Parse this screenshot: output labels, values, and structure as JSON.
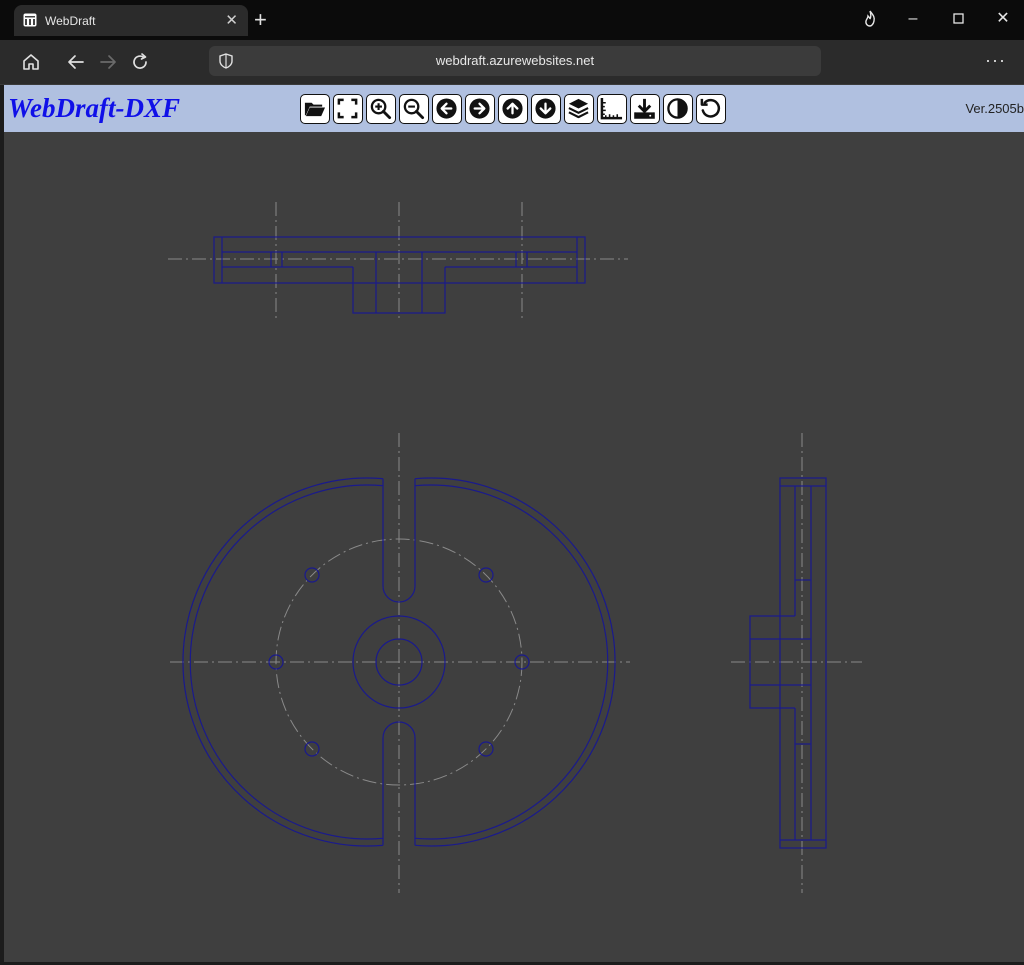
{
  "browser": {
    "tab_title": "WebDraft",
    "url": "webdraft.azurewebsites.net",
    "tab_close_icon": "close-icon",
    "new_tab_icon": "plus-icon",
    "window_controls": [
      "flame-icon",
      "minimize-icon",
      "maximize-icon",
      "close-icon"
    ],
    "nav_icons": [
      "home-icon",
      "back-arrow-icon",
      "forward-arrow-icon",
      "reload-icon"
    ],
    "security_icon": "shield-icon",
    "menu_icon": "more-dots-icon"
  },
  "app": {
    "logo": "WebDraft-DXF",
    "version": "Ver.2505b",
    "toolbar": [
      {
        "name": "open",
        "icon": "folder-open-icon"
      },
      {
        "name": "fit",
        "icon": "fullscreen-frame-icon"
      },
      {
        "name": "zoom-in",
        "icon": "zoom-in-icon"
      },
      {
        "name": "zoom-out",
        "icon": "zoom-out-icon"
      },
      {
        "name": "pan-left",
        "icon": "arrow-left-icon"
      },
      {
        "name": "pan-right",
        "icon": "arrow-right-icon"
      },
      {
        "name": "pan-up",
        "icon": "arrow-up-icon"
      },
      {
        "name": "pan-down",
        "icon": "arrow-down-icon"
      },
      {
        "name": "layers",
        "icon": "layers-icon"
      },
      {
        "name": "measure",
        "icon": "ruler-corner-icon"
      },
      {
        "name": "download",
        "icon": "download-icon"
      },
      {
        "name": "contrast",
        "icon": "contrast-icon"
      },
      {
        "name": "reset",
        "icon": "undo-icon"
      }
    ]
  },
  "colors": {
    "canvas_bg": "#3f3f3f",
    "header_bg": "#b0c0e0",
    "logo": "#1010e8",
    "part_outline": "#1a1a8c",
    "center_line": "#8a8a8a"
  }
}
